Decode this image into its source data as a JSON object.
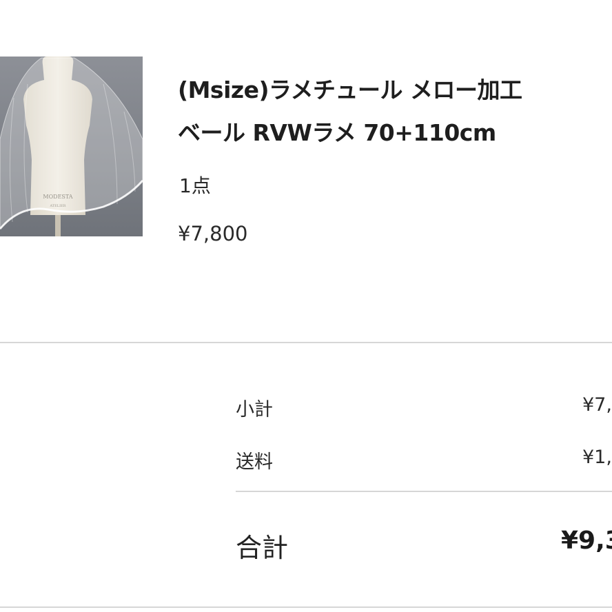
{
  "product": {
    "title_line1": "(Msize)ラメチュール メロー加工",
    "title_line2": "ベール RVWラメ 70+110cm",
    "quantity": "1点",
    "price": "¥7,800",
    "image_text": [
      "MODESTA",
      "ATELIER"
    ]
  },
  "summary": {
    "subtotal_label": "小計",
    "subtotal_value": "¥7,",
    "shipping_label": "送料",
    "shipping_value": "¥1,",
    "total_label": "合計",
    "total_value": "¥9,3"
  }
}
